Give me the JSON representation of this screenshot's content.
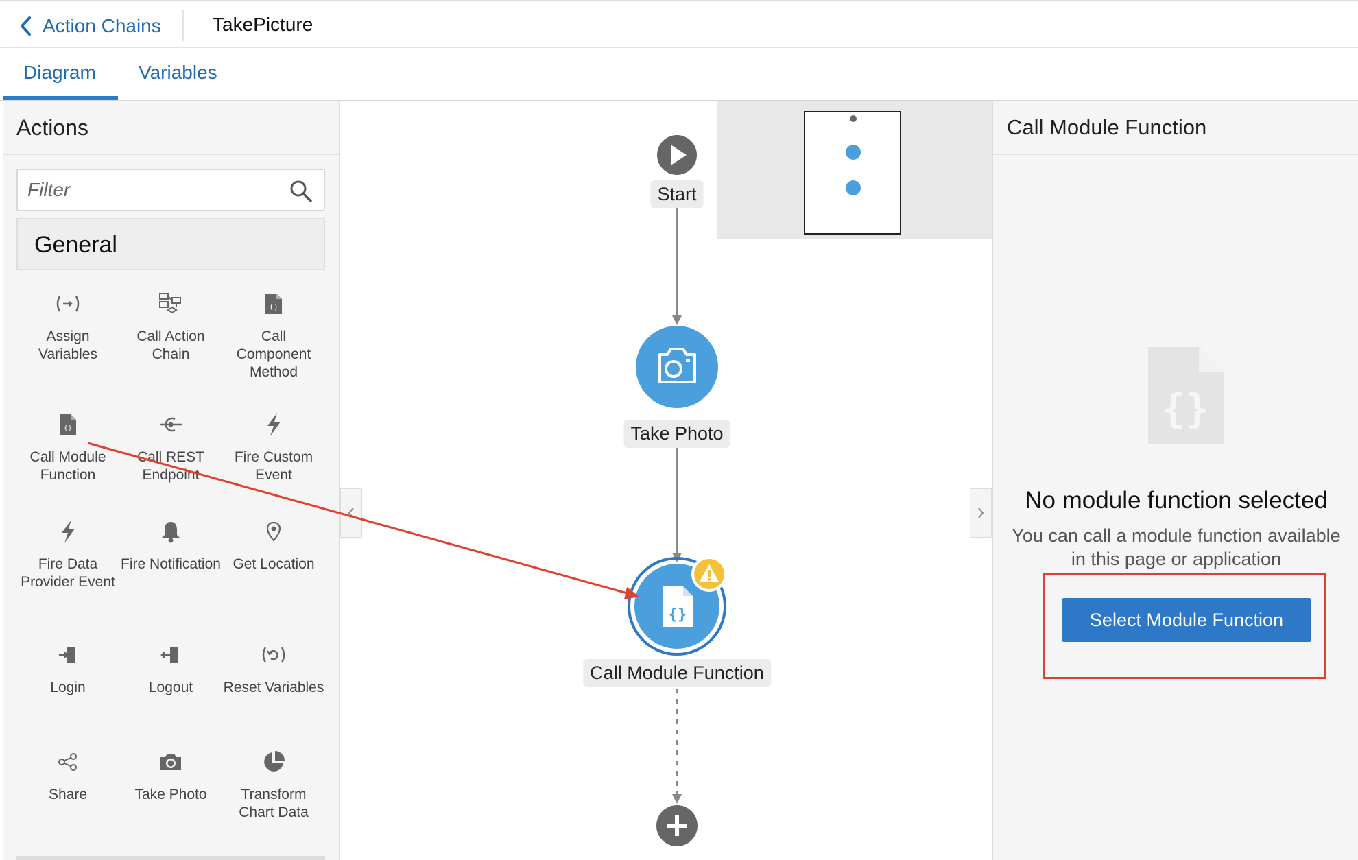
{
  "header": {
    "back_label": "Action Chains",
    "chain_name": "TakePicture"
  },
  "tabs": [
    {
      "label": "Diagram",
      "active": true
    },
    {
      "label": "Variables",
      "active": false
    }
  ],
  "actions_panel": {
    "title": "Actions",
    "filter_placeholder": "Filter",
    "section": "General",
    "items": [
      {
        "label": "Assign Variables",
        "icon": "assign-variables-icon"
      },
      {
        "label": "Call Action Chain",
        "icon": "action-chain-icon"
      },
      {
        "label": "Call Component Method",
        "icon": "component-method-icon"
      },
      {
        "label": "Call Module Function",
        "icon": "module-function-icon"
      },
      {
        "label": "Call REST Endpoint",
        "icon": "rest-endpoint-icon"
      },
      {
        "label": "Fire Custom Event",
        "icon": "lightning-icon"
      },
      {
        "label": "Fire Data Provider Event",
        "icon": "lightning-icon"
      },
      {
        "label": "Fire Notification",
        "icon": "bell-icon"
      },
      {
        "label": "Get Location",
        "icon": "location-pin-icon"
      },
      {
        "label": "Login",
        "icon": "login-icon"
      },
      {
        "label": "Logout",
        "icon": "logout-icon"
      },
      {
        "label": "Reset Variables",
        "icon": "reset-variables-icon"
      },
      {
        "label": "Share",
        "icon": "share-icon"
      },
      {
        "label": "Take Photo",
        "icon": "camera-icon"
      },
      {
        "label": "Transform Chart Data",
        "icon": "pie-chart-icon"
      }
    ]
  },
  "diagram": {
    "nodes": [
      {
        "label": "Start",
        "icon": "play-icon"
      },
      {
        "label": "Take Photo",
        "icon": "camera-icon"
      },
      {
        "label": "Call Module Function",
        "icon": "module-function-icon",
        "warning": true
      }
    ]
  },
  "properties_panel": {
    "title": "Call Module Function",
    "empty_title": "No module function selected",
    "empty_hint": "You can call a module function available in this page or application",
    "button_label": "Select Module Function"
  },
  "colors": {
    "accent": "#2d79c7",
    "node_blue": "#4a9fdc",
    "warning": "#f2c23a",
    "annotation_red": "#e0412e"
  }
}
